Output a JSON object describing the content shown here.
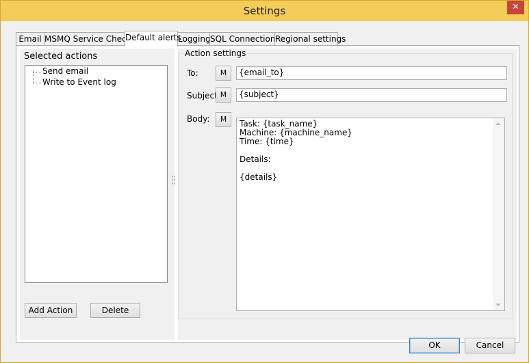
{
  "window": {
    "title": "Settings",
    "close_glyph": "✕"
  },
  "tabs": [
    {
      "label": "Email"
    },
    {
      "label": "MSMQ Service Check"
    },
    {
      "label": "Default alerts",
      "active": true
    },
    {
      "label": "Logging"
    },
    {
      "label": "SQL Connections"
    },
    {
      "label": "Regional settings"
    }
  ],
  "left": {
    "heading": "Selected actions",
    "items": [
      "Send email",
      "Write to Event log"
    ],
    "add_label": "Add Action",
    "delete_label": "Delete"
  },
  "action_settings": {
    "heading": "Action settings",
    "to_label": "To:",
    "to_value": "{email_to}",
    "subject_label": "Subject:",
    "subject_value": "{subject}",
    "body_label": "Body:",
    "macro_label": "M",
    "body_lines": [
      "Task: {task_name}",
      "Machine: {machine_name}",
      "Time: {time}",
      "",
      "Details:",
      "",
      "{details}"
    ]
  },
  "footer": {
    "ok_label": "OK",
    "cancel_label": "Cancel"
  }
}
